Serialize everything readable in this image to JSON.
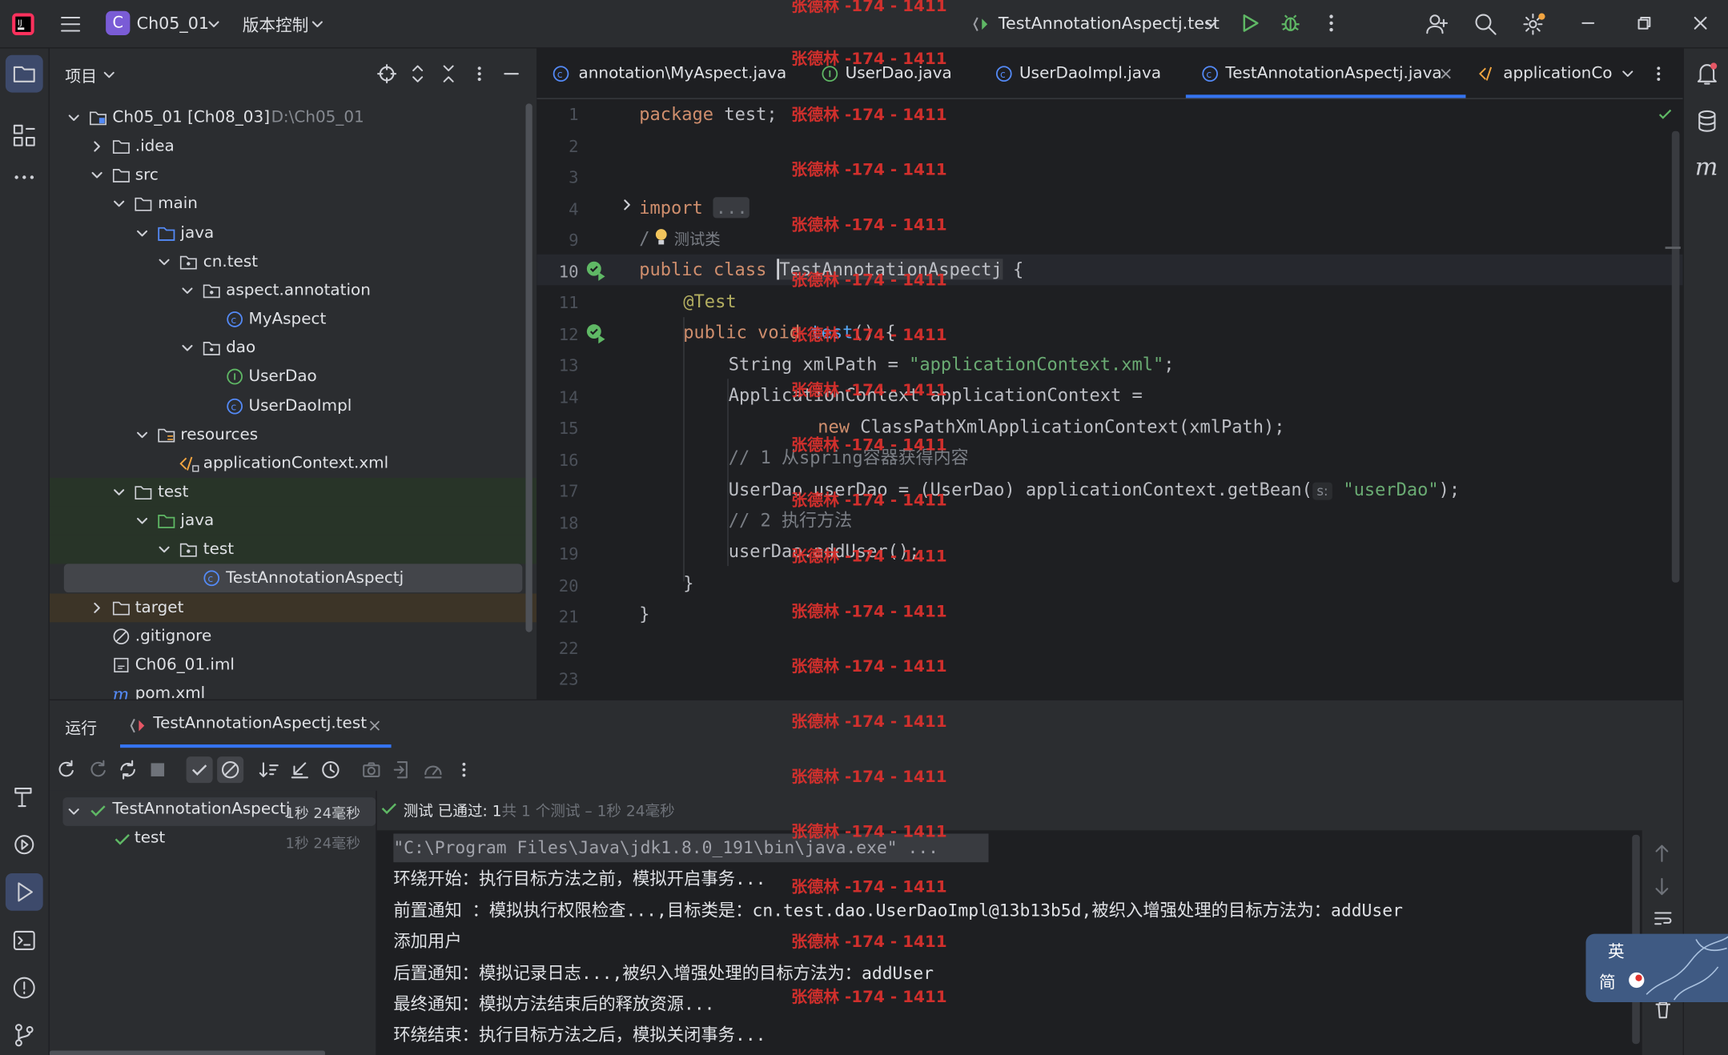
{
  "titlebar": {
    "project_badge": "C",
    "project_name": "Ch05_01",
    "vcs_label": "版本控制",
    "run_config": "TestAnnotationAspectj.test"
  },
  "project_panel": {
    "title": "项目",
    "tree": [
      {
        "label": "Ch05_01 [Ch08_03]",
        "path": "D:\\Ch05_01",
        "depth": 0,
        "expanded": true,
        "icon": "module-folder-icon"
      },
      {
        "label": ".idea",
        "depth": 1,
        "expanded": false,
        "icon": "folder-icon"
      },
      {
        "label": "src",
        "depth": 1,
        "expanded": true,
        "icon": "folder-icon"
      },
      {
        "label": "main",
        "depth": 2,
        "expanded": true,
        "icon": "folder-icon"
      },
      {
        "label": "java",
        "depth": 3,
        "expanded": true,
        "icon": "source-folder-icon"
      },
      {
        "label": "cn.test",
        "depth": 4,
        "expanded": true,
        "icon": "package-icon"
      },
      {
        "label": "aspect.annotation",
        "depth": 5,
        "expanded": true,
        "icon": "package-icon"
      },
      {
        "label": "MyAspect",
        "depth": 6,
        "icon": "class-icon"
      },
      {
        "label": "dao",
        "depth": 5,
        "expanded": true,
        "icon": "package-icon"
      },
      {
        "label": "UserDao",
        "depth": 6,
        "icon": "interface-icon"
      },
      {
        "label": "UserDaoImpl",
        "depth": 6,
        "icon": "class-icon"
      },
      {
        "label": "resources",
        "depth": 3,
        "expanded": true,
        "icon": "resources-folder-icon"
      },
      {
        "label": "applicationContext.xml",
        "depth": 4,
        "icon": "xml-file-icon"
      },
      {
        "label": "test",
        "depth": 2,
        "expanded": true,
        "icon": "folder-icon"
      },
      {
        "label": "java",
        "depth": 3,
        "expanded": true,
        "icon": "test-source-folder-icon"
      },
      {
        "label": "test",
        "depth": 4,
        "expanded": true,
        "icon": "package-icon"
      },
      {
        "label": "TestAnnotationAspectj",
        "depth": 5,
        "icon": "class-icon"
      },
      {
        "label": "target",
        "depth": 1,
        "expanded": false,
        "icon": "folder-icon"
      },
      {
        "label": ".gitignore",
        "depth": 1,
        "icon": "ignore-file-icon"
      },
      {
        "label": "Ch06_01.iml",
        "depth": 1,
        "icon": "iml-file-icon"
      },
      {
        "label": "pom.xml",
        "depth": 1,
        "icon": "maven-icon"
      }
    ]
  },
  "editor": {
    "tabs": [
      {
        "label": "annotation\\MyAspect.java",
        "icon": "class-icon"
      },
      {
        "label": "UserDao.java",
        "icon": "interface-icon"
      },
      {
        "label": "UserDaoImpl.java",
        "icon": "class-icon"
      },
      {
        "label": "TestAnnotationAspectj.java",
        "icon": "class-icon",
        "active": true
      },
      {
        "label": "applicationCo",
        "icon": "xml-file-icon"
      }
    ],
    "line_numbers": [
      "1",
      "2",
      "3",
      "4",
      "9",
      "10",
      "11",
      "12",
      "13",
      "14",
      "15",
      "16",
      "17",
      "18",
      "19",
      "20",
      "21",
      "22",
      "23"
    ],
    "code": {
      "l1_kw": "package",
      "l1_rest": " test;",
      "l4_kw": "import",
      "l4_fold": "...",
      "l9_prefix": "/",
      "l9_comment": "测试类",
      "l10_kw": "public class",
      "l10_name": "TestAnnotationAspectj",
      "l10_brace": " {",
      "l11_ann": "@Test",
      "l12_kw": "public void",
      "l12_fn": "test",
      "l12_rest": "() {",
      "l13_a": "String xmlPath = ",
      "l13_str": "\"applicationContext.xml\"",
      "l13_b": ";",
      "l14": "ApplicationContext applicationContext =",
      "l15_kw": "new",
      "l15_rest": " ClassPathXmlApplicationContext(xmlPath);",
      "l16": "// 1 从spring容器获得内容",
      "l17_a": "UserDao userDao = (UserDao) applicationContext.getBean(",
      "l17_hint": "s:",
      "l17_str": "\"userDao\"",
      "l17_b": ");",
      "l18": "// 2 执行方法",
      "l19": "userDao.addUser();",
      "l20": "}",
      "l21": "}"
    }
  },
  "run_panel": {
    "tab_label": "运行",
    "config_tab": "TestAnnotationAspectj.test",
    "test_tree": [
      {
        "label": "TestAnnotationAspectj",
        "time": "1秒 24毫秒"
      },
      {
        "label": "test",
        "time": "1秒 24毫秒"
      }
    ],
    "status_strong": "测试 已通过: 1",
    "status_rest": "共 1 个测试 – 1秒 24毫秒",
    "console": [
      "\"C:\\Program Files\\Java\\jdk1.8.0_191\\bin\\java.exe\" ...",
      "环绕开始：执行目标方法之前，模拟开启事务...",
      "前置通知 ：模拟执行权限检查...,目标类是：cn.test.dao.UserDaoImpl@13b13b5d,被织入增强处理的目标方法为：addUser",
      "添加用户",
      "后置通知：模拟记录日志...,被织入增强处理的目标方法为：addUser",
      "最终通知：模拟方法结束后的释放资源...",
      "环绕结束：执行目标方法之后，模拟关闭事务..."
    ]
  },
  "ime": {
    "top": "英",
    "bottom": "简"
  },
  "watermark": "张德林 -174 - 1411",
  "colors": {
    "accent": "#3574f0",
    "success": "#5fb865",
    "keyword": "#cf8e6d",
    "string": "#6aab73",
    "watermark": "#e0312d"
  }
}
